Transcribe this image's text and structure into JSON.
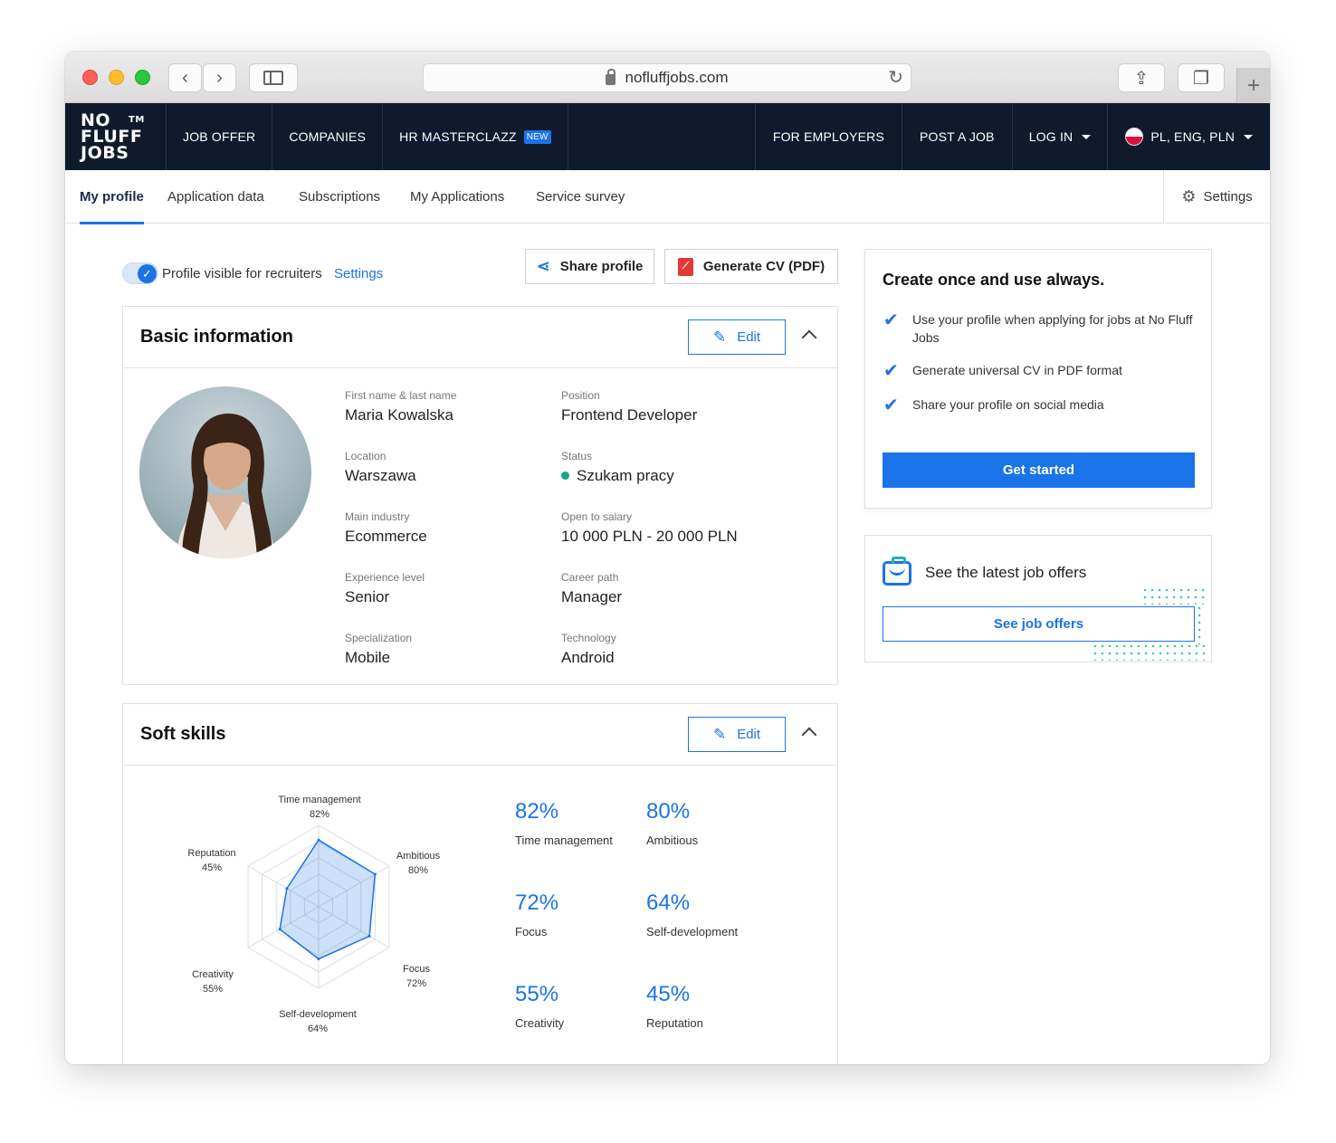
{
  "browser": {
    "url": "nofluffjobs.com"
  },
  "nav": {
    "logo": [
      "NO",
      "FLUFF",
      "JOBS"
    ],
    "logo_tm": "TM",
    "items": [
      "JOB OFFER",
      "COMPANIES",
      "HR MASTERCLAZZ"
    ],
    "new_badge": "NEW",
    "right_items": [
      "FOR EMPLOYERS",
      "POST A JOB",
      "LOG IN"
    ],
    "locale": "PL, ENG, PLN"
  },
  "subnav": {
    "tabs": [
      "My profile",
      "Application data",
      "Subscriptions",
      "My Applications",
      "Service survey"
    ],
    "settings": "Settings"
  },
  "profile_bar": {
    "visible_label": "Profile visible for recruiters",
    "settings_link": "Settings",
    "share_btn": "Share profile",
    "cv_btn": "Generate CV (PDF)"
  },
  "basic": {
    "title": "Basic information",
    "edit": "Edit",
    "fields": [
      {
        "label": "First name & last name",
        "value": "Maria Kowalska"
      },
      {
        "label": "Position",
        "value": "Frontend Developer"
      },
      {
        "label": "Location",
        "value": "Warszawa"
      },
      {
        "label": "Status",
        "value": "Szukam pracy"
      },
      {
        "label": "Main industry",
        "value": "Ecommerce"
      },
      {
        "label": "Open to salary",
        "value": "10 000 PLN - 20 000 PLN"
      },
      {
        "label": "Experience level",
        "value": "Senior"
      },
      {
        "label": "Career path",
        "value": "Manager"
      },
      {
        "label": "Specialization",
        "value": "Mobile"
      },
      {
        "label": "Technology",
        "value": "Android"
      }
    ],
    "status_color": "#17a589"
  },
  "promo": {
    "title": "Create once and use always.",
    "items": [
      "Use your profile when applying for jobs at No Fluff Jobs",
      "Generate universal CV in PDF format",
      "Share your profile on social media"
    ],
    "cta": "Get started"
  },
  "jobs": {
    "title": "See the latest job offers",
    "cta": "See job offers"
  },
  "soft_skills": {
    "title": "Soft skills",
    "edit": "Edit",
    "skills": [
      {
        "name": "Time management",
        "value": 82,
        "label": "82%"
      },
      {
        "name": "Ambitious",
        "value": 80,
        "label": "80%"
      },
      {
        "name": "Focus",
        "value": 72,
        "label": "72%"
      },
      {
        "name": "Self-development",
        "value": 64,
        "label": "64%"
      },
      {
        "name": "Creativity",
        "value": 55,
        "label": "55%"
      },
      {
        "name": "Reputation",
        "value": 45,
        "label": "45%"
      }
    ]
  },
  "colors": {
    "accent": "#1a73e8",
    "nav_bg": "#0f1b2d"
  }
}
